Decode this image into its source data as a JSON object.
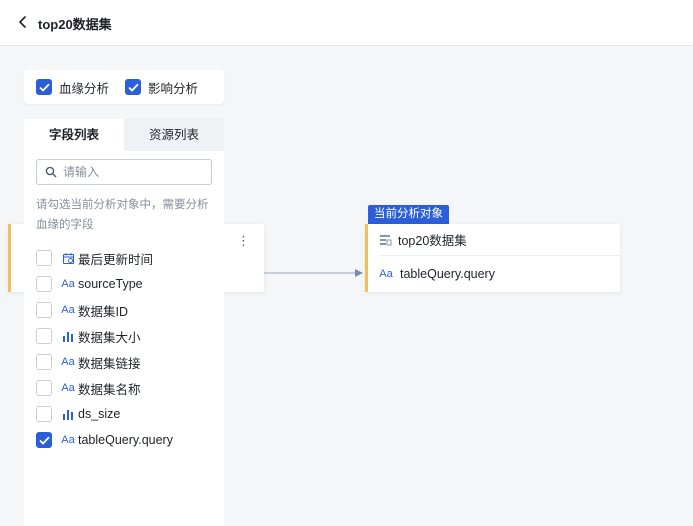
{
  "header": {
    "title": "top20数据集"
  },
  "analysis": {
    "lineage": {
      "label": "血缘分析",
      "checked": true
    },
    "impact": {
      "label": "影响分析",
      "checked": true
    }
  },
  "panel": {
    "tabs": [
      {
        "label": "字段列表",
        "active": true
      },
      {
        "label": "资源列表",
        "active": false
      }
    ],
    "search_placeholder": "请输入",
    "hint": "请勾选当前分析对象中，需要分析血缘的字段",
    "fields": [
      {
        "name": "最后更新时间",
        "type": "date-icon",
        "checked": false
      },
      {
        "name": "sourceType",
        "type": "text-icon",
        "checked": false
      },
      {
        "name": "数据集ID",
        "type": "text-icon",
        "checked": false
      },
      {
        "name": "数据集大小",
        "type": "number-icon",
        "checked": false
      },
      {
        "name": "数据集链接",
        "type": "text-icon",
        "checked": false
      },
      {
        "name": "数据集名称",
        "type": "text-icon",
        "checked": false
      },
      {
        "name": "ds_size",
        "type": "number-icon",
        "checked": false
      },
      {
        "name": "tableQuery.query",
        "type": "text-icon",
        "checked": true
      }
    ]
  },
  "graph": {
    "current_tag": "当前分析对象",
    "target_node": {
      "title": "top20数据集",
      "field": "tableQuery.query"
    }
  },
  "colors": {
    "accent": "#2b5fd9",
    "node_border": "#f0c15b",
    "edge": "#a9b4c8"
  }
}
